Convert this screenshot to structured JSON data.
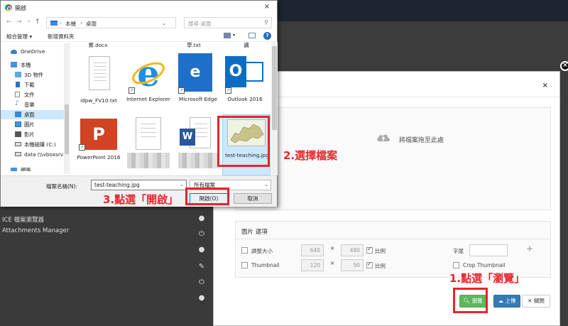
{
  "dialog": {
    "title": "開啟",
    "close": "×",
    "nav": {
      "back": "←",
      "forward": "→",
      "up": "↑",
      "down": "⌄"
    },
    "address": {
      "parts": [
        "本機",
        "桌面"
      ],
      "sep": "›",
      "refresh": "↻"
    },
    "search": {
      "placeholder": "搜尋 桌面",
      "icon": "search-icon"
    },
    "toolbar": {
      "organize": "組合管理 ▾",
      "new_folder": "新增資料夾",
      "view": "▾"
    },
    "nav_pane": [
      {
        "label": "OneDrive",
        "icon": "cloud-icon",
        "color": "#2f80d1"
      },
      {
        "label": "本機",
        "icon": "computer-icon",
        "color": "#4a90d9"
      },
      {
        "label": "3D 物件",
        "icon": "cube-icon",
        "color": "#5fa9e6"
      },
      {
        "label": "下載",
        "icon": "download-icon",
        "color": "#2a6fc9"
      },
      {
        "label": "文件",
        "icon": "document-icon",
        "color": "#888"
      },
      {
        "label": "音樂",
        "icon": "music-icon",
        "color": "#3b7bd1"
      },
      {
        "label": "桌面",
        "icon": "desktop-icon",
        "color": "#3e86d6",
        "selected": true
      },
      {
        "label": "圖片",
        "icon": "picture-icon",
        "color": "#4a90d9"
      },
      {
        "label": "影片",
        "icon": "video-icon",
        "color": "#555"
      },
      {
        "label": "本機磁碟 (C:)",
        "icon": "drive-icon",
        "color": "#666"
      },
      {
        "label": "data (\\\\vboxsrv",
        "icon": "network-drive-icon",
        "color": "#666"
      },
      {
        "label": "網路",
        "icon": "network-icon",
        "color": "#4a90d9"
      }
    ],
    "files_partial_top": [
      "實.docx",
      "學.txt",
      "講"
    ],
    "files": [
      {
        "name": "idpw_FV10.txt",
        "icon": "text-file-icon"
      },
      {
        "name": "Internet Explorer",
        "icon": "ie-icon"
      },
      {
        "name": "Microsoft Edge",
        "icon": "edge-icon"
      },
      {
        "name": "Outlook 2016",
        "icon": "outlook-icon"
      },
      {
        "name": "PowerPoint 2016",
        "icon": "powerpoint-icon"
      },
      {
        "name": "",
        "icon": "text-file-icon"
      },
      {
        "name": "",
        "icon": "word-icon"
      },
      {
        "name": "test-teaching.jpg",
        "icon": "image-thumbnail-icon",
        "selected": true
      }
    ],
    "filename_label": "檔案名稱(N):",
    "filename_value": "test-teaching.jpg",
    "filetype_value": "所有檔案",
    "open_button": "開啟(O)",
    "cancel_button": "取消"
  },
  "background": {
    "menu_items": [
      "ICE 檔案瀏覽器",
      "Attachments Manager"
    ]
  },
  "modal": {
    "close": "×",
    "dropzone_text": "將檔案拖至此處",
    "options_title": "圖片 選項",
    "resize_label": "調整大小",
    "resize_w": "640",
    "resize_h": "480",
    "ratio_label": "比例",
    "thumbnail_label": "Thumbnail",
    "thumb_w": "120",
    "thumb_h": "90",
    "thumb_ratio_label": "比例",
    "suffix_label": "字尾",
    "crop_label": "Crop Thumbnail",
    "times": "×",
    "plus": "+",
    "browse_button": "瀏覽",
    "upload_button": "上傳",
    "close_button": "關閉"
  },
  "annotations": {
    "step1": "1.點選「瀏覽」",
    "step2": "2.選擇檔案",
    "step3": "3.點選「開啟」"
  }
}
